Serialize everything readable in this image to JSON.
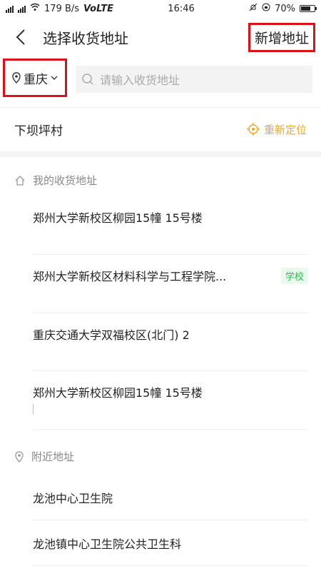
{
  "status_bar": {
    "network_speed": "179 B/s",
    "network_type": "VoLTE",
    "time": "16:46",
    "battery": "70%",
    "battery_level": 0.7
  },
  "header": {
    "title": "选择收货地址",
    "add_button": "新增地址"
  },
  "search": {
    "city": "重庆",
    "placeholder": "请输入收货地址"
  },
  "current_location": {
    "name": "下坝坪村",
    "relocate_label": "重新定位"
  },
  "my_addresses": {
    "heading": "我的收货地址",
    "items": [
      {
        "text": "郑州大学新校区柳园15幢 15号楼",
        "tag": ""
      },
      {
        "text": "郑州大学新校区材料科学与工程学院...",
        "tag": "学校"
      },
      {
        "text": "重庆交通大学双福校区(北门) 2",
        "tag": ""
      },
      {
        "text": "郑州大学新校区柳园15幢 15号楼",
        "tag": ""
      }
    ]
  },
  "nearby": {
    "heading": "附近地址",
    "items": [
      "龙池中心卫生院",
      "龙池镇中心卫生院公共卫生科"
    ]
  },
  "colors": {
    "highlight_border": "#e0101a",
    "accent_orange": "#f5a623",
    "tag_green": "#2db84d"
  }
}
